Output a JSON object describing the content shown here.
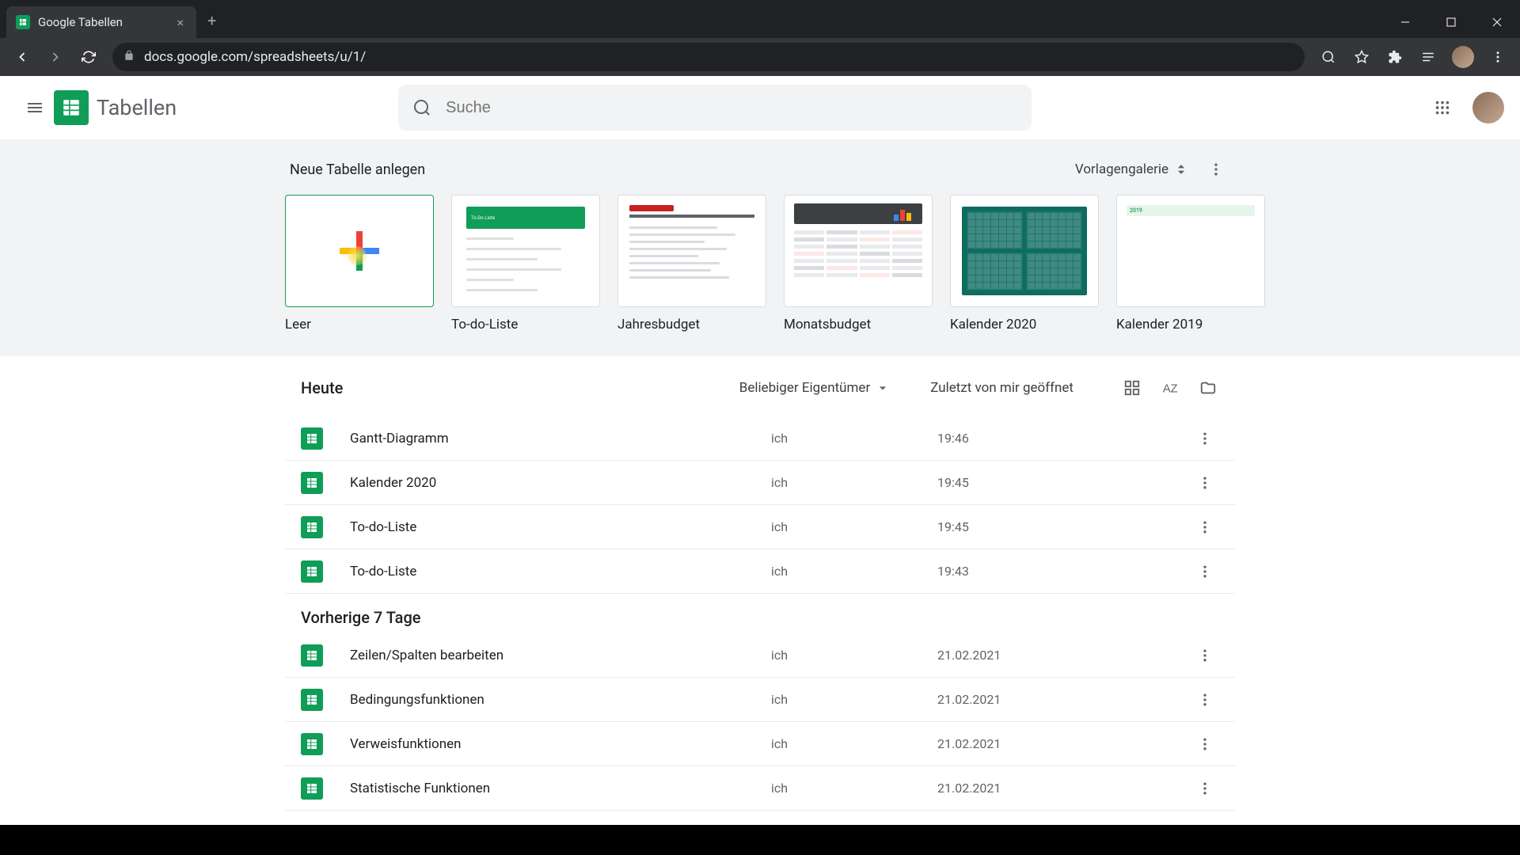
{
  "browser": {
    "tab_title": "Google Tabellen",
    "url": "docs.google.com/spreadsheets/u/1/"
  },
  "header": {
    "app_title": "Tabellen",
    "search_placeholder": "Suche"
  },
  "templates": {
    "section_title": "Neue Tabelle anlegen",
    "gallery_label": "Vorlagengalerie",
    "items": [
      {
        "label": "Leer"
      },
      {
        "label": "To-do-Liste"
      },
      {
        "label": "Jahresbudget"
      },
      {
        "label": "Monatsbudget"
      },
      {
        "label": "Kalender 2020"
      },
      {
        "label": "Kalender 2019"
      }
    ]
  },
  "docs": {
    "owner_filter": "Beliebiger Eigentümer",
    "sort_label": "Zuletzt von mir geöffnet",
    "sections": [
      {
        "label": "Heute",
        "rows": [
          {
            "name": "Gantt-Diagramm",
            "owner": "ich",
            "date": "19:46"
          },
          {
            "name": "Kalender 2020",
            "owner": "ich",
            "date": "19:45"
          },
          {
            "name": "To-do-Liste",
            "owner": "ich",
            "date": "19:45"
          },
          {
            "name": "To-do-Liste",
            "owner": "ich",
            "date": "19:43"
          }
        ]
      },
      {
        "label": "Vorherige 7 Tage",
        "rows": [
          {
            "name": "Zeilen/Spalten bearbeiten",
            "owner": "ich",
            "date": "21.02.2021"
          },
          {
            "name": "Bedingungsfunktionen",
            "owner": "ich",
            "date": "21.02.2021"
          },
          {
            "name": "Verweisfunktionen",
            "owner": "ich",
            "date": "21.02.2021"
          },
          {
            "name": "Statistische Funktionen",
            "owner": "ich",
            "date": "21.02.2021"
          }
        ]
      }
    ]
  },
  "thumb_labels": {
    "todo_header": "To-Do Liste",
    "cal2019_year": "2019"
  }
}
